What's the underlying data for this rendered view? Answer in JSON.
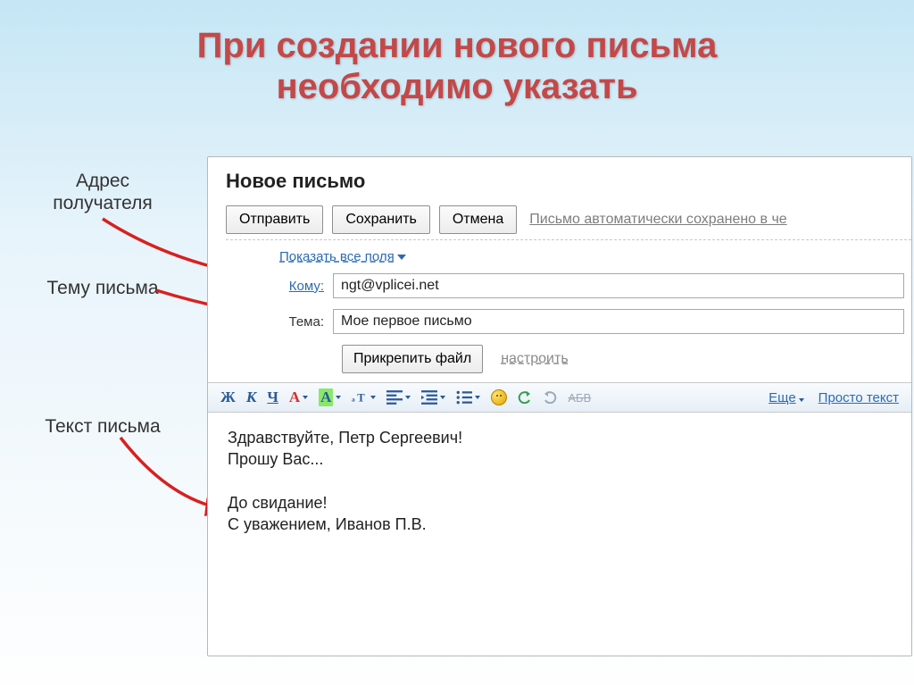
{
  "title_line1": "При создании нового письма",
  "title_line2": "необходимо указать",
  "labels": {
    "recipient": "Адрес\nполучателя",
    "subject": "Тему письма",
    "body": "Текст письма"
  },
  "compose": {
    "title": "Новое письмо",
    "send": "Отправить",
    "save": "Сохранить",
    "cancel": "Отмена",
    "autosave": "Письмо автоматически сохранено в че",
    "show_all_fields": "Показать все поля",
    "to_label": "Кому:",
    "to_value": "ngt@vplicei.net",
    "subject_label": "Тема:",
    "subject_value": "Мое первое письмо",
    "attach": "Прикрепить файл",
    "configure": "настроить",
    "rt": {
      "bold": "Ж",
      "italic": "К",
      "underline": "Ч",
      "fontcolor": "A",
      "highlight": "A",
      "more": "Еще",
      "plaintext": "Просто текст",
      "abv": "АБВ"
    },
    "body_text": "Здравствуйте, Петр Сергеевич!\nПрошу Вас...\n\nДо свидание!\nС уважением, Иванов П.В."
  }
}
